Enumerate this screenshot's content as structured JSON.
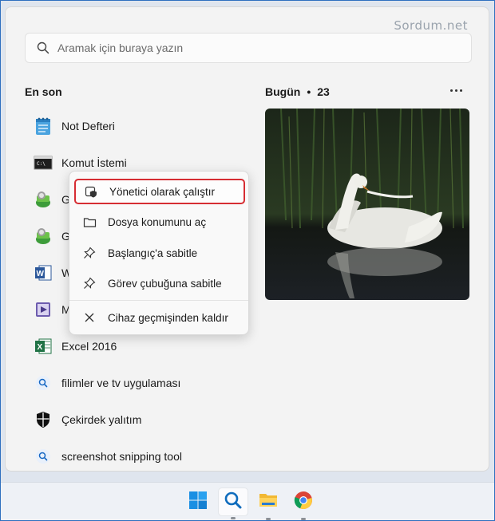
{
  "watermark": "Sordum.net",
  "search": {
    "placeholder": "Aramak için buraya yazın"
  },
  "recent": {
    "title": "En son",
    "items": [
      {
        "label": "Not Defteri",
        "icon": "notepad-icon"
      },
      {
        "label": "Komut İstemi",
        "icon": "command-prompt-icon"
      },
      {
        "label": "G",
        "icon": "green-app-icon"
      },
      {
        "label": "G",
        "icon": "green-app-icon"
      },
      {
        "label": "W",
        "icon": "word-icon"
      },
      {
        "label": "M",
        "icon": "media-icon"
      },
      {
        "label": "Excel 2016",
        "icon": "excel-icon"
      },
      {
        "label": "filimler ve tv uygulaması",
        "icon": "search-icon"
      },
      {
        "label": "Çekirdek yalıtım",
        "icon": "shield-icon"
      },
      {
        "label": "screenshot snipping tool",
        "icon": "search-icon"
      }
    ]
  },
  "today": {
    "title": "Bugün",
    "separator": "•",
    "count": "23"
  },
  "context_menu": {
    "items": [
      {
        "label": "Yönetici olarak çalıştır",
        "icon": "admin-shield-icon",
        "selected": true
      },
      {
        "label": "Dosya konumunu aç",
        "icon": "folder-icon"
      },
      {
        "label": "Başlangıç'a sabitle",
        "icon": "pin-icon"
      },
      {
        "label": "Görev çubuğuna sabitle",
        "icon": "pin-icon"
      },
      {
        "label": "Cihaz geçmişinden kaldır",
        "icon": "close-icon"
      }
    ]
  },
  "taskbar": {
    "items": [
      "windows-start-icon",
      "search-icon",
      "file-explorer-icon",
      "chrome-icon"
    ]
  },
  "colors": {
    "accent": "#0f6cbd",
    "selection_border": "#d62d33",
    "panel_bg": "#f3f3f3"
  }
}
